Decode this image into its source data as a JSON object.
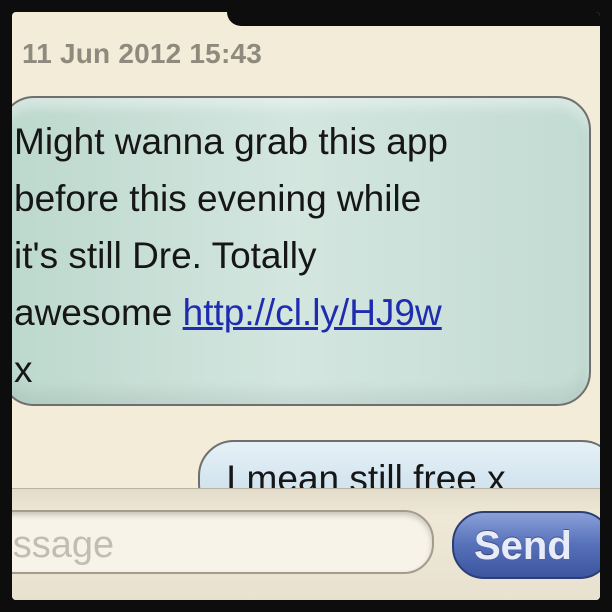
{
  "conversation": {
    "timestamp": "11 Jun 2012 15:43",
    "received_message": {
      "line1": "Might wanna grab this app",
      "line2": "before this evening while",
      "line3": "it's still Dre. Totally",
      "line4_text": "awesome ",
      "link": "http://cl.ly/HJ9w",
      "line5": "x"
    },
    "sent_message": "I mean still free x"
  },
  "compose": {
    "placeholder": "Message",
    "send_label": "Send"
  },
  "colors": {
    "received_bubble": "#c8e0d7",
    "sent_bubble": "#d6e7f2",
    "send_button": "#5670b9",
    "link": "#1f2cb0"
  }
}
